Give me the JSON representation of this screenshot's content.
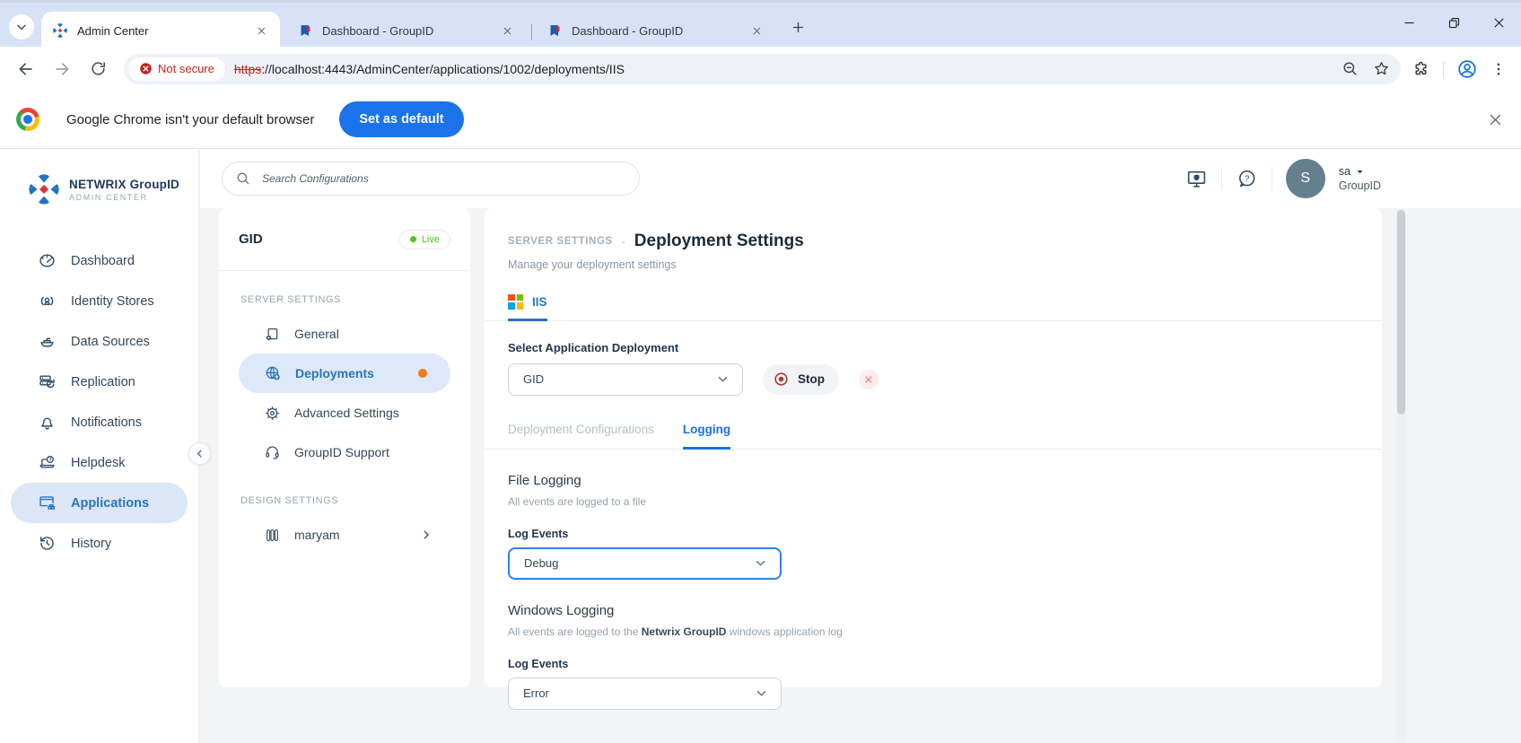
{
  "colors": {
    "accent_blue": "#1a73e8",
    "app_blue": "#2b74b8",
    "live_green": "#52c41a",
    "alert_orange": "#f07b16",
    "stop_red": "#a93c33",
    "danger_red": "#c5221f"
  },
  "browser": {
    "tabs": [
      {
        "title": "Admin Center",
        "active": true
      },
      {
        "title": "Dashboard - GroupID",
        "active": false
      },
      {
        "title": "Dashboard - GroupID",
        "active": false
      }
    ],
    "not_secure_label": "Not secure",
    "url_scheme": "https",
    "url_rest": "://localhost:4443/AdminCenter/applications/1002/deployments/IIS",
    "infobar": {
      "message": "Google Chrome isn't your default browser",
      "button_label": "Set as default"
    }
  },
  "topbar": {
    "search_placeholder": "Search Configurations",
    "user": {
      "initial": "S",
      "name": "sa",
      "org": "GroupID"
    }
  },
  "sidebar": {
    "brand_name": "NETWRIX GroupID",
    "brand_subtitle": "ADMIN CENTER",
    "items": [
      {
        "label": "Dashboard"
      },
      {
        "label": "Identity Stores"
      },
      {
        "label": "Data Sources"
      },
      {
        "label": "Replication"
      },
      {
        "label": "Notifications"
      },
      {
        "label": "Helpdesk"
      },
      {
        "label": "Applications",
        "active": true
      },
      {
        "label": "History"
      }
    ]
  },
  "config_panel": {
    "name": "GID",
    "status": "Live",
    "server_settings_label": "SERVER SETTINGS",
    "items": [
      {
        "label": "General"
      },
      {
        "label": "Deployments",
        "active": true
      },
      {
        "label": "Advanced Settings"
      },
      {
        "label": "GroupID Support"
      }
    ],
    "design_settings_label": "DESIGN SETTINGS",
    "design_item": "maryam"
  },
  "main": {
    "breadcrumb": "SERVER SETTINGS",
    "breadcrumb_sep": "-",
    "title": "Deployment Settings",
    "subtitle": "Manage your deployment settings",
    "platform_tab": "IIS",
    "select_label": "Select Application Deployment",
    "deployment_value": "GID",
    "stop_label": "Stop",
    "tabs": [
      {
        "label": "Deployment Configurations",
        "active": false
      },
      {
        "label": "Logging",
        "active": true
      }
    ],
    "log_events_label": "Log Events",
    "file_logging": {
      "title": "File Logging",
      "description": "All events are logged to a file",
      "value": "Debug"
    },
    "windows_logging": {
      "title": "Windows Logging",
      "description_pre": "All events are logged to the ",
      "description_bold": "Netwrix GroupID",
      "description_post": " windows application log",
      "value": "Error"
    }
  }
}
